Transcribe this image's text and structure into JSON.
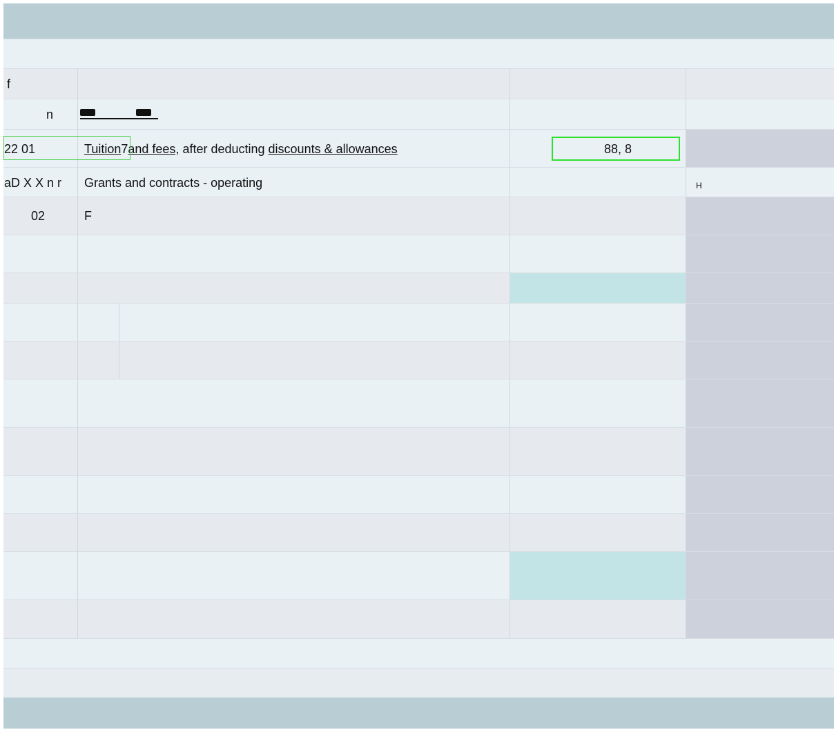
{
  "rows": {
    "r3": {
      "c1": "f"
    },
    "r4": {
      "c1": "n"
    },
    "r5": {
      "c1": "22  01",
      "link1": "Tuition",
      "mid": "7",
      "link2": "and fees,",
      "plain": " after deducting ",
      "link3": "discounts & allowances",
      "amount": "88, 8"
    },
    "r6": {
      "c1": "aD X X n r",
      "c2": "Grants and contracts - operating",
      "c4": "H"
    },
    "r7": {
      "c1": "02",
      "c2": "F"
    }
  },
  "colors": {
    "header": "#b8ced4",
    "row_light": "#e9f1f5",
    "row_dark": "#e6eaee",
    "gray_cell": "#cdd1dc",
    "teal_cell": "#c3e4e6",
    "highlight": "#2ee02e"
  }
}
